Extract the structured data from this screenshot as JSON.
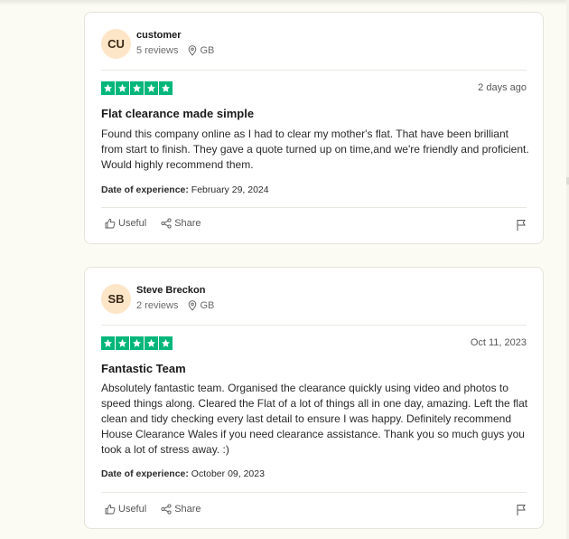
{
  "reviews": [
    {
      "initials": "CU",
      "name": "customer",
      "review_count": "5 reviews",
      "country": "GB",
      "date": "2 days ago",
      "title": "Flat clearance made simple",
      "body": "Found this company online as I had to clear my mother's flat. That have been brilliant from start to finish. They gave a quote turned up on time,and we're friendly and proficient. Would highly recommend them.",
      "experience_label": "Date of experience:",
      "experience_date": "February 29, 2024",
      "useful_label": "Useful",
      "share_label": "Share",
      "rating": 5
    },
    {
      "initials": "SB",
      "name": "Steve Breckon",
      "review_count": "2 reviews",
      "country": "GB",
      "date": "Oct 11, 2023",
      "title": "Fantastic Team",
      "body": "Absolutely fantastic team. Organised the clearance quickly using video and photos to speed things along. Cleared the Flat of a lot of things all in one day, amazing. Left the flat clean and tidy checking every last detail to ensure I was happy. Definitely recommend House Clearance Wales if you need clearance assistance. Thank you so much guys you took a lot of stress away. :)",
      "experience_label": "Date of experience:",
      "experience_date": "October 09, 2023",
      "useful_label": "Useful",
      "share_label": "Share",
      "rating": 5
    }
  ],
  "colors": {
    "star_green": "#00b67a",
    "avatar_bg": "#fde5c7",
    "page_bg": "#fcfbf3"
  },
  "icons": {
    "location": "location-pin-icon",
    "useful": "thumbs-up-icon",
    "share": "share-icon",
    "report": "flag-icon",
    "star": "star-icon"
  }
}
